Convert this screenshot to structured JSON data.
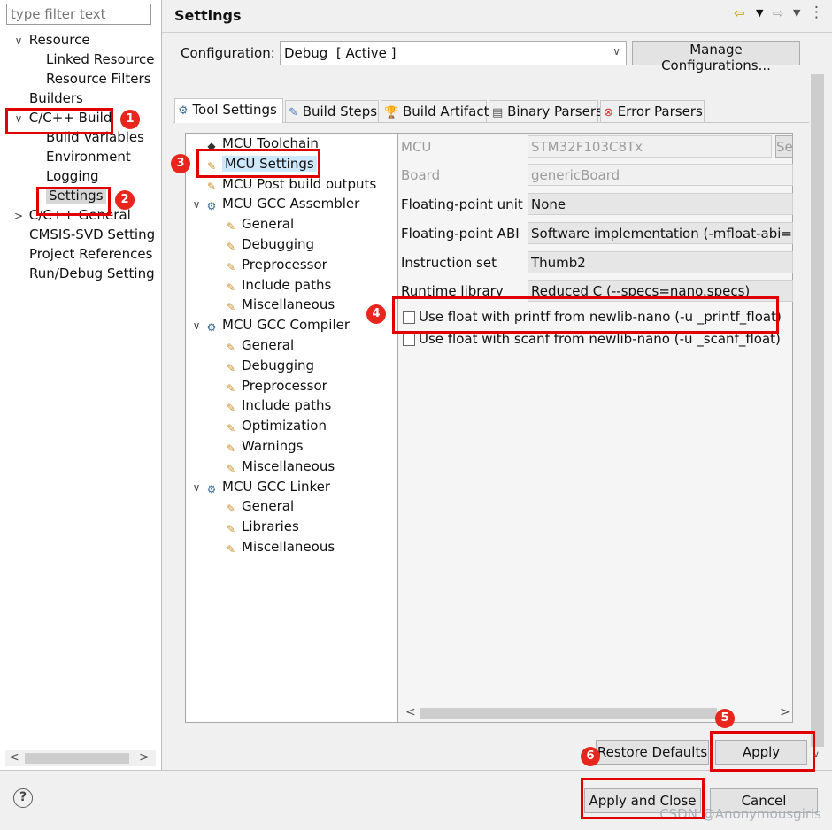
{
  "left": {
    "filter_placeholder": "type filter text",
    "items": [
      {
        "label": "Resource",
        "twisty": "∨"
      },
      {
        "label": "Linked Resource"
      },
      {
        "label": "Resource Filters"
      },
      {
        "label": "Builders"
      },
      {
        "label": "C/C++ Build",
        "twisty": "∨"
      },
      {
        "label": "Build Variables"
      },
      {
        "label": "Environment"
      },
      {
        "label": "Logging"
      },
      {
        "label": "Settings"
      },
      {
        "label": "C/C++ General",
        "twisty": ">"
      },
      {
        "label": "CMSIS-SVD Setting"
      },
      {
        "label": "Project References"
      },
      {
        "label": "Run/Debug Setting"
      }
    ]
  },
  "header": {
    "title": "Settings"
  },
  "config": {
    "label": "Configuration:",
    "value": "Debug  [ Active ]",
    "manage_label": "Manage Configurations..."
  },
  "tabs": [
    "Tool Settings",
    "Build Steps",
    "Build Artifact",
    "Binary Parsers",
    "Error Parsers"
  ],
  "tree": [
    {
      "label": "MCU Toolchain",
      "level": 0,
      "icon": "chip-icon"
    },
    {
      "label": "MCU Settings",
      "level": 0,
      "icon": "wrench-icon"
    },
    {
      "label": "MCU Post build outputs",
      "level": 0,
      "icon": "wrench-icon"
    },
    {
      "label": "MCU GCC Assembler",
      "level": 0,
      "icon": "gear-icon",
      "twisty": "∨"
    },
    {
      "label": "General",
      "level": 1,
      "icon": "wrench-icon"
    },
    {
      "label": "Debugging",
      "level": 1,
      "icon": "wrench-icon"
    },
    {
      "label": "Preprocessor",
      "level": 1,
      "icon": "wrench-icon"
    },
    {
      "label": "Include paths",
      "level": 1,
      "icon": "wrench-icon"
    },
    {
      "label": "Miscellaneous",
      "level": 1,
      "icon": "wrench-icon"
    },
    {
      "label": "MCU GCC Compiler",
      "level": 0,
      "icon": "gear-icon",
      "twisty": "∨"
    },
    {
      "label": "General",
      "level": 1,
      "icon": "wrench-icon"
    },
    {
      "label": "Debugging",
      "level": 1,
      "icon": "wrench-icon"
    },
    {
      "label": "Preprocessor",
      "level": 1,
      "icon": "wrench-icon"
    },
    {
      "label": "Include paths",
      "level": 1,
      "icon": "wrench-icon"
    },
    {
      "label": "Optimization",
      "level": 1,
      "icon": "wrench-icon"
    },
    {
      "label": "Warnings",
      "level": 1,
      "icon": "wrench-icon"
    },
    {
      "label": "Miscellaneous",
      "level": 1,
      "icon": "wrench-icon"
    },
    {
      "label": "MCU GCC Linker",
      "level": 0,
      "icon": "gear-icon",
      "twisty": "∨"
    },
    {
      "label": "General",
      "level": 1,
      "icon": "wrench-icon"
    },
    {
      "label": "Libraries",
      "level": 1,
      "icon": "wrench-icon"
    },
    {
      "label": "Miscellaneous",
      "level": 1,
      "icon": "wrench-icon"
    }
  ],
  "settings": {
    "mcu_label": "MCU",
    "mcu_value": "STM32F103C8Tx",
    "mcu_button": "Se",
    "board_label": "Board",
    "board_value": "genericBoard",
    "fpu_label": "Floating-point unit",
    "fpu_value": "None",
    "abi_label": "Floating-point ABI",
    "abi_value": "Software implementation (-mfloat-abi=so",
    "iset_label": "Instruction set",
    "iset_value": "Thumb2",
    "rt_label": "Runtime library",
    "rt_value": "Reduced C (--specs=nano.specs)",
    "printf_label": "Use float with printf from newlib-nano (-u _printf_float)",
    "scanf_label": "Use float with scanf from newlib-nano (-u _scanf_float)"
  },
  "buttons": {
    "restore_defaults": "Restore Defaults",
    "apply": "Apply",
    "apply_and_close": "Apply and Close",
    "cancel": "Cancel"
  },
  "badges": [
    "1",
    "2",
    "3",
    "4",
    "5",
    "6"
  ],
  "watermark": "CSDN @Anonymousgirls",
  "colors": {
    "annotation_red": "#e00000",
    "badge_red": "#e8261e"
  }
}
